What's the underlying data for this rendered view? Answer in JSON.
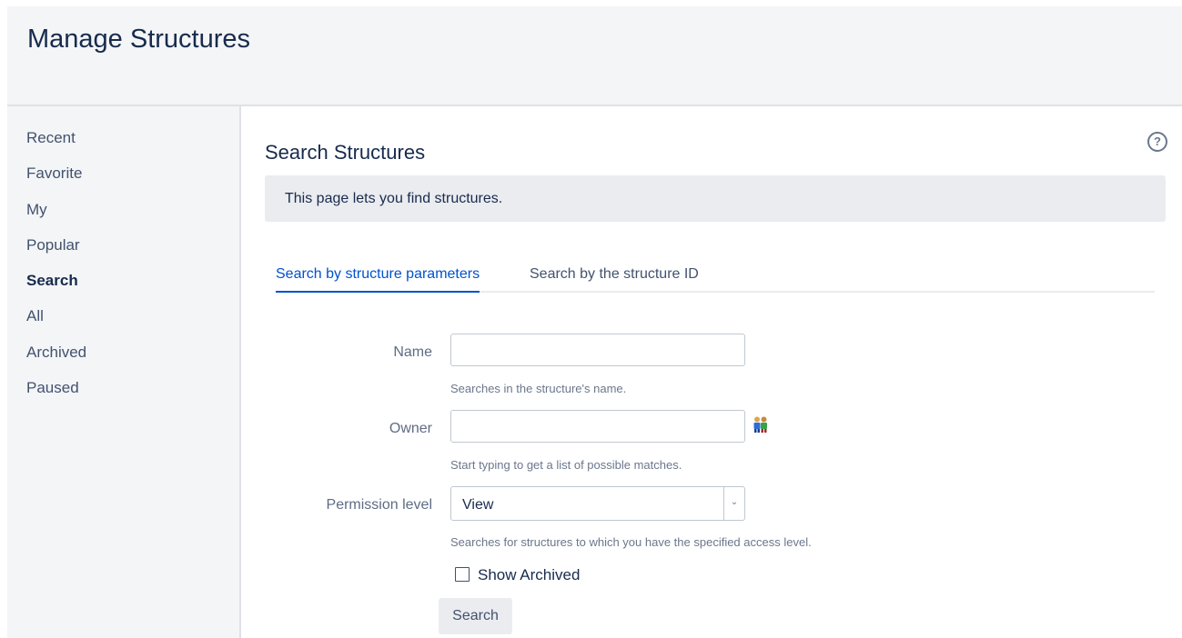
{
  "header": {
    "title": "Manage Structures"
  },
  "sidebar": {
    "items": [
      {
        "label": "Recent"
      },
      {
        "label": "Favorite"
      },
      {
        "label": "My"
      },
      {
        "label": "Popular"
      },
      {
        "label": "Search",
        "active": true
      },
      {
        "label": "All"
      },
      {
        "label": "Archived"
      },
      {
        "label": "Paused"
      }
    ]
  },
  "main": {
    "help_icon": "help-icon",
    "help_glyph": "?",
    "title": "Search Structures",
    "info": "This page lets you find structures.",
    "tabs": [
      {
        "label": "Search by structure parameters",
        "active": true
      },
      {
        "label": "Search by the structure ID",
        "active": false
      }
    ],
    "form": {
      "name": {
        "label": "Name",
        "value": "",
        "hint": "Searches in the structure's name."
      },
      "owner": {
        "label": "Owner",
        "value": "",
        "hint": "Start typing to get a list of possible matches.",
        "icon": "user-picker-icon"
      },
      "permission": {
        "label": "Permission level",
        "selected": "View",
        "hint": "Searches for structures to which you have the specified access level."
      },
      "show_archived": {
        "label": "Show Archived",
        "checked": false
      },
      "search_button": "Search"
    }
  },
  "colors": {
    "accent": "#0052cc",
    "header_bg": "#f4f5f7",
    "info_bg": "#ebecf0"
  }
}
